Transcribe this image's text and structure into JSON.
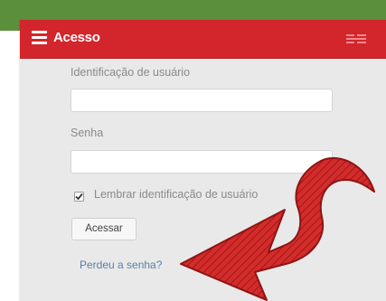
{
  "header": {
    "title": "Acesso",
    "menu_icon": "hamburger-menu-icon",
    "dock_icon": "dock-block-icon"
  },
  "form": {
    "username_label": "Identificação de usuário",
    "username_value": "",
    "password_label": "Senha",
    "password_value": "",
    "remember_label": "Lembrar identificação de usuário",
    "remember_checked": true,
    "submit_label": "Acessar",
    "forgot_link": "Perdeu a senha?"
  },
  "annotation": {
    "icon": "red-arrow-icon"
  },
  "colors": {
    "header": "#d3252c",
    "top_bar": "#5c8f3c",
    "panel": "#e9e9e9",
    "arrow": "#d42b2b"
  }
}
